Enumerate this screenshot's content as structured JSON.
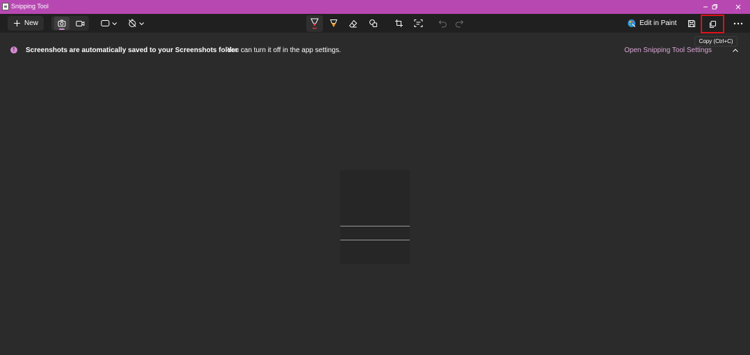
{
  "window": {
    "title": "Snipping Tool"
  },
  "toolbar": {
    "new_label": "New",
    "edit_in_paint_label": "Edit in Paint",
    "copy_tooltip": "Copy (Ctrl+C)"
  },
  "infobar": {
    "message_bold": "Screenshots are automatically saved to your Screenshots folder",
    "message_sub": "You can turn it off in the app settings.",
    "settings_link": "Open Snipping Tool Settings"
  },
  "icons": {
    "new": "plus-icon",
    "photo_mode": "camera-icon",
    "video_mode": "video-camera-icon",
    "snip_shape": "rectangle-icon",
    "timer": "timer-off-icon",
    "pen": "ballpoint-pen-icon",
    "highlighter": "highlighter-icon",
    "eraser": "eraser-icon",
    "shapes": "shapes-icon",
    "crop": "crop-icon",
    "text_actions": "text-actions-icon",
    "undo": "undo-icon",
    "redo": "redo-icon",
    "paint": "paint-icon",
    "save": "save-icon",
    "copy": "copy-icon",
    "more": "more-icon",
    "info": "info-icon",
    "collapse": "chevron-up-icon"
  },
  "colors": {
    "titlebar": "#b748b2",
    "accent": "#d78bd4",
    "link": "#d9a6d6",
    "highlight_box": "#e0101a",
    "background": "#2b2b2b",
    "toolbar": "#202020"
  }
}
